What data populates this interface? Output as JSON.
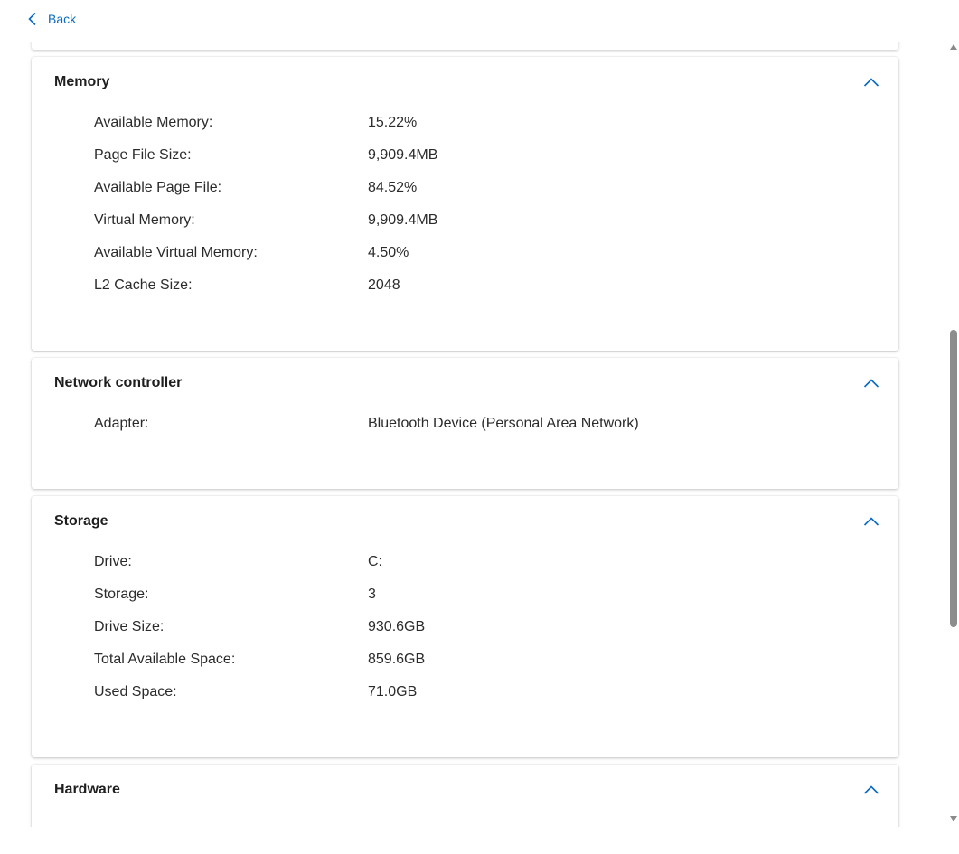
{
  "nav": {
    "back_label": "Back"
  },
  "colors": {
    "accent": "#0a6bc2",
    "text": "#2b2b2b"
  },
  "sections": {
    "memory": {
      "title": "Memory",
      "rows": [
        {
          "label": "Available Memory:",
          "value": "15.22%"
        },
        {
          "label": "Page File Size:",
          "value": "9,909.4MB"
        },
        {
          "label": "Available Page File:",
          "value": "84.52%"
        },
        {
          "label": "Virtual Memory:",
          "value": "9,909.4MB"
        },
        {
          "label": "Available Virtual Memory:",
          "value": "4.50%"
        },
        {
          "label": "L2 Cache Size:",
          "value": "2048"
        }
      ]
    },
    "network": {
      "title": "Network controller",
      "rows": [
        {
          "label": "Adapter:",
          "value": "Bluetooth Device (Personal Area Network)"
        }
      ]
    },
    "storage": {
      "title": "Storage",
      "rows": [
        {
          "label": "Drive:",
          "value": "C:"
        },
        {
          "label": "Storage:",
          "value": "3"
        },
        {
          "label": "Drive Size:",
          "value": "930.6GB"
        },
        {
          "label": "Total Available Space:",
          "value": "859.6GB"
        },
        {
          "label": "Used Space:",
          "value": "71.0GB"
        }
      ]
    },
    "hardware": {
      "title": "Hardware"
    }
  },
  "icons": {
    "back": "chevron-left-icon",
    "collapse": "chevron-up-icon"
  }
}
